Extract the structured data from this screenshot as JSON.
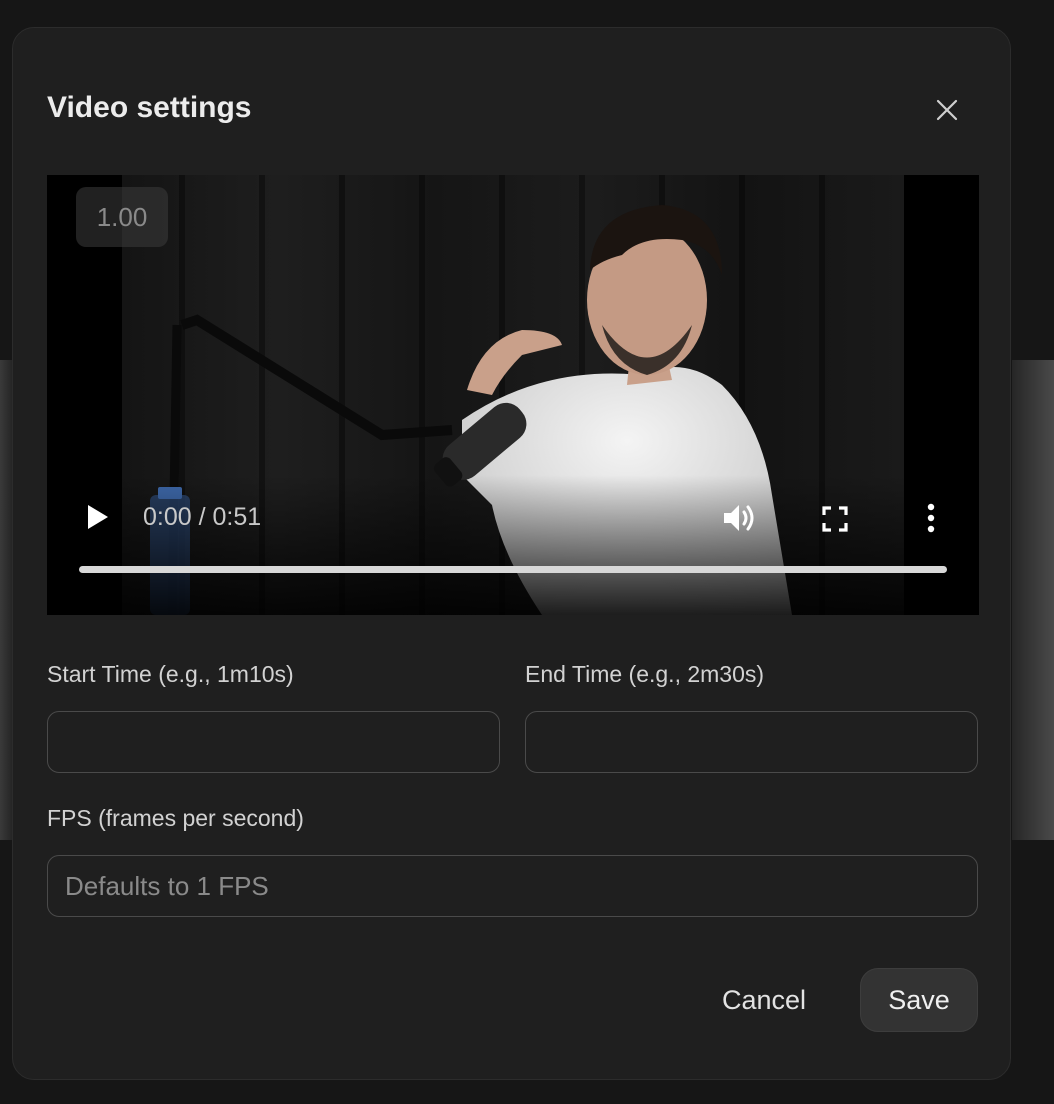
{
  "dialog": {
    "title": "Video settings",
    "close_icon": "close-icon"
  },
  "video": {
    "playback_speed": "1.00",
    "current_time": "0:00",
    "duration": "0:51",
    "time_display": "0:00 / 0:51",
    "progress_fraction": 0,
    "icons": {
      "play": "play-icon",
      "volume": "volume-icon",
      "fullscreen": "fullscreen-icon",
      "more": "more-vertical-icon"
    }
  },
  "fields": {
    "start_time": {
      "label": "Start Time (e.g., 1m10s)",
      "value": "",
      "placeholder": ""
    },
    "end_time": {
      "label": "End Time (e.g., 2m30s)",
      "value": "",
      "placeholder": ""
    },
    "fps": {
      "label": "FPS (frames per second)",
      "value": "",
      "placeholder": "Defaults to 1 FPS"
    }
  },
  "actions": {
    "cancel_label": "Cancel",
    "save_label": "Save"
  },
  "colors": {
    "dialog_bg": "#1f1f1f",
    "input_border": "#4a4a4a",
    "save_bg": "#333333",
    "text_primary": "#ececec"
  }
}
